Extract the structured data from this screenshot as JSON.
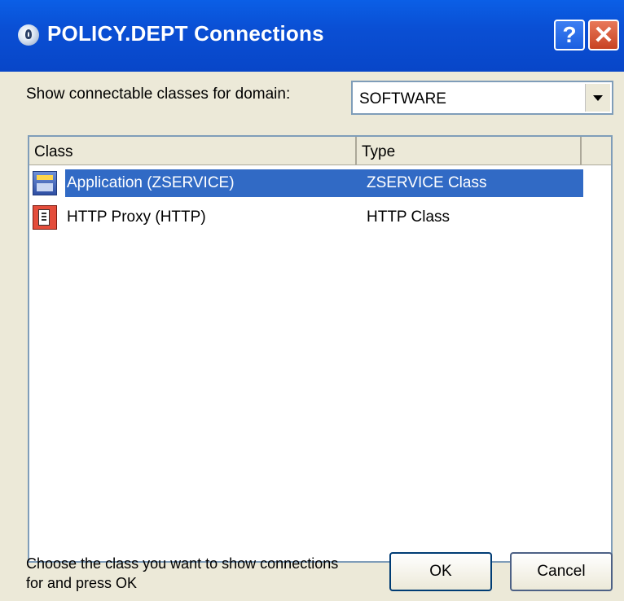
{
  "window": {
    "title": "POLICY.DEPT Connections",
    "help_icon": "?",
    "close_icon": "✕"
  },
  "domain": {
    "label": "Show connectable classes for domain:",
    "selected": "SOFTWARE"
  },
  "list": {
    "columns": [
      "Class",
      "Type",
      ""
    ],
    "rows": [
      {
        "name": "Application (ZSERVICE)",
        "type": "ZSERVICE Class",
        "icon": "application-icon",
        "selected": true
      },
      {
        "name": "HTTP Proxy (HTTP)",
        "type": "HTTP Class",
        "icon": "http-proxy-icon",
        "selected": false
      }
    ]
  },
  "footer": {
    "instruction": "Choose the class you want to show connections for and press OK",
    "ok_label": "OK",
    "cancel_label": "Cancel"
  },
  "colors": {
    "title_bar": "#0a4fd4",
    "selection": "#316ac5",
    "dialog_bg": "#ece9d8"
  }
}
